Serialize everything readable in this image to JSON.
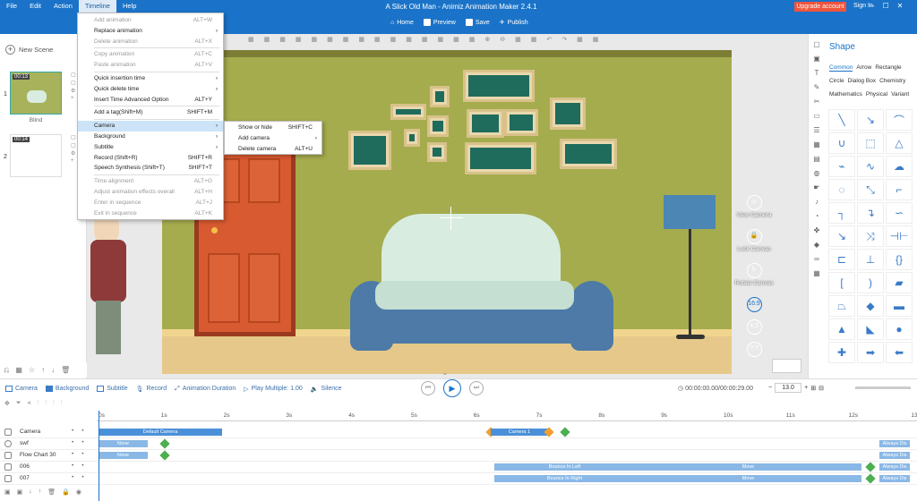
{
  "menubar": [
    "File",
    "Edit",
    "Action",
    "Timeline",
    "Help"
  ],
  "app_title": "A Slick Old Man - Animiz Animation Maker 2.4.1",
  "upgrade_label": "Upgrade account",
  "signin_label": "Sign In",
  "toolbar": {
    "home": "Home",
    "preview": "Preview",
    "save": "Save",
    "publish": "Publish"
  },
  "new_scene_label": "New Scene",
  "scenes": [
    {
      "num": "1",
      "time": "00:13",
      "label": "Blind"
    },
    {
      "num": "2",
      "time": "00:14",
      "label": ""
    }
  ],
  "timeline_menu": [
    {
      "label": "Add animation",
      "shortcut": "ALT+W",
      "disabled": true
    },
    {
      "label": "Replace animation",
      "shortcut": "",
      "arrow": true
    },
    {
      "label": "Delete animation",
      "shortcut": "ALT+X",
      "disabled": true
    },
    {
      "sep": true
    },
    {
      "label": "Copy animation",
      "shortcut": "ALT+C",
      "disabled": true
    },
    {
      "label": "Paste animation",
      "shortcut": "ALT+V",
      "disabled": true
    },
    {
      "sep": true
    },
    {
      "label": "Quick insertion time",
      "shortcut": "",
      "arrow": true
    },
    {
      "label": "Quick delete time",
      "shortcut": "",
      "arrow": true
    },
    {
      "label": "Insert Time Advanced Option",
      "shortcut": "ALT+Y"
    },
    {
      "sep": true
    },
    {
      "label": "Add a tag(Shift+M)",
      "shortcut": "SHIFT+M"
    },
    {
      "sep": true
    },
    {
      "label": "Camera",
      "shortcut": "",
      "arrow": true,
      "highlight": true
    },
    {
      "label": "Background",
      "shortcut": "",
      "arrow": true
    },
    {
      "label": "Subtitle",
      "shortcut": "",
      "arrow": true
    },
    {
      "label": "Record (Shift+R)",
      "shortcut": "SHIFT+R"
    },
    {
      "label": "Speech Synthesis (Shift+T)",
      "shortcut": "SHIFT+T"
    },
    {
      "sep": true
    },
    {
      "label": "Time alignment",
      "shortcut": "ALT+G",
      "disabled": true
    },
    {
      "label": "Adjust animation effects overall",
      "shortcut": "ALT+H",
      "disabled": true
    },
    {
      "label": "Enter in sequence",
      "shortcut": "ALT+J",
      "disabled": true
    },
    {
      "label": "Exit in sequence",
      "shortcut": "ALT+K",
      "disabled": true
    }
  ],
  "camera_submenu": [
    {
      "label": "Show or hide",
      "shortcut": "SHIFT+C"
    },
    {
      "label": "Add camera",
      "shortcut": "",
      "arrow": true
    },
    {
      "label": "Delete camera",
      "shortcut": "ALT+U"
    }
  ],
  "camera_controls": {
    "view": "View Camera",
    "lock": "Lock Canvas",
    "rotate": "Rotate Canvas",
    "r169": "16:9",
    "r43": "4:3",
    "rq": "?:?"
  },
  "right_panel": {
    "title": "Shape",
    "tabs_row1": [
      "Common",
      "Arrow",
      "Rectangle"
    ],
    "tabs_row2": [
      "Circle",
      "Dialog Box",
      "Chemistry"
    ],
    "tabs_row3": [
      "Mathematics",
      "Physical",
      "Variant"
    ]
  },
  "bottom_toolbar": {
    "camera": "Camera",
    "background": "Background",
    "subtitle": "Subtitle",
    "record": "Record",
    "anim_duration": "Animation Duration",
    "play_multiple": "Play Multiple: 1.00",
    "silence": "Silence"
  },
  "time_display": "00:00:00.00/00:00:29.00",
  "zoom_value": "13.0",
  "ruler_ticks": [
    "0s",
    "1s",
    "2s",
    "3s",
    "4s",
    "5s",
    "6s",
    "7s",
    "8s",
    "9s",
    "10s",
    "11s",
    "12s",
    "13s"
  ],
  "tracks": [
    {
      "name": "Camera"
    },
    {
      "name": "swf"
    },
    {
      "name": "Flow Chart 30"
    },
    {
      "name": "006"
    },
    {
      "name": "007"
    }
  ],
  "clips": {
    "default_camera": "Default Camera",
    "camera1": "Camera 1",
    "none": "None",
    "bounce_left": "Bounce In Left",
    "bounce_right": "Bounce In Right",
    "move": "Move",
    "always": "Always Dis"
  },
  "colors": {
    "brand": "#1a73c8",
    "upgrade": "#f0543c",
    "wall": "#a5ac4d",
    "door": "#d85a30",
    "sofa": "#4d7aa7"
  }
}
